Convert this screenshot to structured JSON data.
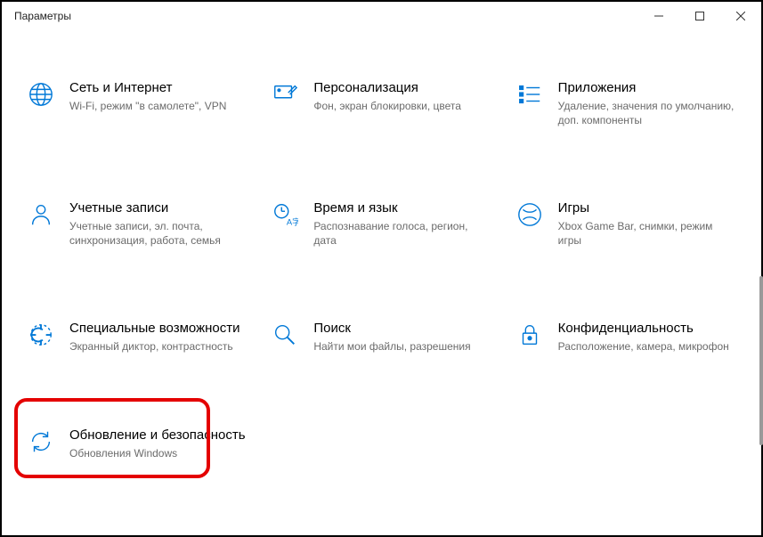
{
  "window": {
    "title": "Параметры"
  },
  "tiles": [
    {
      "title": "Сеть и Интернет",
      "desc": "Wi-Fi, режим \"в самолете\", VPN"
    },
    {
      "title": "Персонализация",
      "desc": "Фон, экран блокировки, цвета"
    },
    {
      "title": "Приложения",
      "desc": "Удаление, значения по умолчанию, доп. компоненты"
    },
    {
      "title": "Учетные записи",
      "desc": "Учетные записи, эл. почта, синхронизация, работа, семья"
    },
    {
      "title": "Время и язык",
      "desc": "Распознавание голоса, регион, дата"
    },
    {
      "title": "Игры",
      "desc": "Xbox Game Bar, снимки, режим игры"
    },
    {
      "title": "Специальные возможности",
      "desc": "Экранный диктор, контрастность"
    },
    {
      "title": "Поиск",
      "desc": "Найти мои файлы, разрешения"
    },
    {
      "title": "Конфиденциальность",
      "desc": "Расположение, камера, микрофон"
    },
    {
      "title": "Обновление и безопасность",
      "desc": "Обновления Windows"
    }
  ]
}
